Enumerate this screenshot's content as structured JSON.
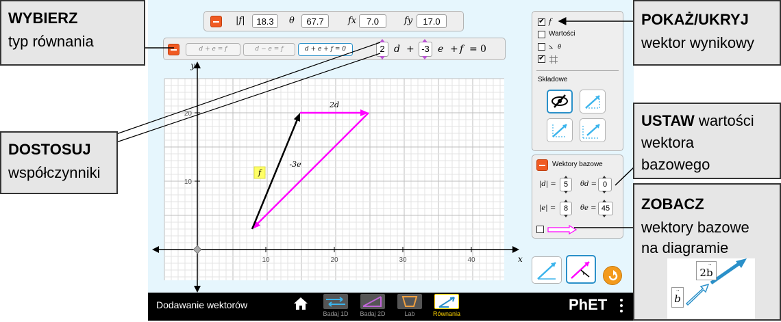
{
  "callouts": {
    "choose": {
      "title": "WYBIERZ",
      "text": "typ równania"
    },
    "adjust": {
      "title": "DOSTOSUJ",
      "text": "współczynniki"
    },
    "show": {
      "title": "POKAŻ/UKRYJ",
      "text": "wektor wynikowy"
    },
    "set": {
      "title": "USTAW",
      "title_rest": " wartości",
      "line2": "wektora",
      "line3": "bazowego"
    },
    "see": {
      "title": "ZOBACZ",
      "line2": "wektory bazowe",
      "line3": "na diagramie",
      "demo_b": "b",
      "demo_2b": "2b"
    }
  },
  "top_panel": {
    "f_mag_label": "|f|",
    "f_mag": "18.3",
    "theta_label": "θ",
    "theta": "67.7",
    "fx_label": "fx",
    "fx": "7.0",
    "fy_label": "fy",
    "fy": "17.0"
  },
  "equation_panel": {
    "types": [
      "d + e = f",
      "d − e = f",
      "d + e + f = 0"
    ],
    "selected_type": 2,
    "coef_d": "2",
    "d_sym": "d",
    "plus1": "+",
    "coef_e": "-3",
    "e_sym": "e",
    "plus2": "+",
    "f_sym": "f",
    "eq": "=",
    "zero": "0"
  },
  "graph": {
    "x_axis_label": "x",
    "y_axis_label": "y",
    "x_ticks": [
      "10",
      "20",
      "30",
      "40"
    ],
    "y_ticks": [
      "10",
      "20"
    ],
    "vectors": [
      {
        "name": "2d",
        "label": "2d",
        "color": "#ff00ff",
        "tail": [
          15,
          20
        ],
        "tip": [
          25,
          20
        ]
      },
      {
        "name": "-3e",
        "label": "-3e",
        "color": "#ff00ff",
        "tail": [
          25,
          20
        ],
        "tip": [
          8,
          3
        ]
      },
      {
        "name": "f",
        "label": "f",
        "color": "#000000",
        "tail": [
          8,
          3
        ],
        "tip": [
          15,
          20
        ]
      }
    ]
  },
  "options_panel": {
    "f_checkbox_label": "f",
    "values_label": "Wartości",
    "angle_label": "θ",
    "components_title": "Składowe"
  },
  "base_panel": {
    "title": "Wektory bazowe",
    "d_mag_label": "|d| =",
    "d_mag": "5",
    "theta_d_label": "θd =",
    "theta_d": "0",
    "e_mag_label": "|e| =",
    "e_mag": "8",
    "theta_e_label": "θe =",
    "theta_e": "45"
  },
  "navbar": {
    "title": "Dodawanie wektorów",
    "tabs": [
      {
        "label": "Badaj 1D"
      },
      {
        "label": "Badaj 2D"
      },
      {
        "label": "Lab"
      },
      {
        "label": "Równania"
      }
    ],
    "active_tab": 3,
    "brand": "PhET"
  },
  "colors": {
    "accent_blue": "#2a90c9",
    "magenta": "#ff00ff",
    "orange": "#f05a22",
    "yellow": "#ffd400"
  }
}
